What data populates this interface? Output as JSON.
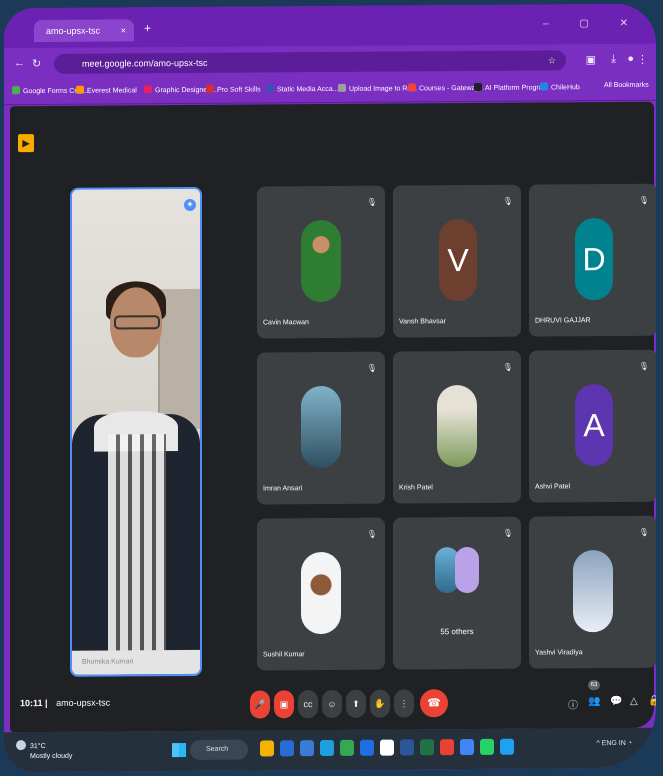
{
  "browser": {
    "tab_title": "amo-upsx-tsc",
    "tab_close": "×",
    "new_tab": "+",
    "window_controls": "– ▢ ✕",
    "url": "meet.google.com/amo-upsx-tsc",
    "bookmarks": [
      {
        "label": "Google Forms Crea...",
        "color": "#4caf50"
      },
      {
        "label": "Everest Medical",
        "color": "#ff9800"
      },
      {
        "label": "Graphic Designers...",
        "color": "#e91e63"
      },
      {
        "label": "Pro Soft Skills",
        "color": "#d32f2f"
      },
      {
        "label": "Static Media Acca...",
        "color": "#3f51b5"
      },
      {
        "label": "Upload Image to Re...",
        "color": "#9e9e9e"
      },
      {
        "label": "Courses - Gateway...",
        "color": "#f44336"
      },
      {
        "label": "AI Platform Program",
        "color": "#212121"
      },
      {
        "label": "ChileHub",
        "color": "#1e88e5"
      }
    ],
    "all_bookmarks": "All Bookmarks"
  },
  "meet": {
    "self_name": "Bhumika Kumari",
    "participants": [
      {
        "name": "Cavin Macwan",
        "type": "photo",
        "color": "#2e7d32"
      },
      {
        "name": "Vansh Bhavsar",
        "type": "letter",
        "letter": "V",
        "color": "#6d3f2f"
      },
      {
        "name": "DHRUVI GAJJAR",
        "type": "letter",
        "letter": "D",
        "color": "#00838f"
      },
      {
        "name": "Imran Ansari",
        "type": "photo",
        "color": "#4a6a80"
      },
      {
        "name": "Krish Patel",
        "type": "photo",
        "color": "#7d9a5a"
      },
      {
        "name": "Ashvi Patel",
        "type": "letter",
        "letter": "A",
        "color": "#5e35b1"
      },
      {
        "name": "Sushil Kumar",
        "type": "photo",
        "color": "#e8e8e8"
      },
      {
        "name": "55 others",
        "type": "others"
      },
      {
        "name": "Yashvi Viradiya",
        "type": "photo",
        "color": "#b3c4d6"
      }
    ],
    "time": "10:11",
    "meeting_code": "amo-upsx-tsc",
    "participant_count": "63"
  },
  "taskbar": {
    "temperature": "31°C",
    "condition": "Mostly cloudy",
    "search": "Search",
    "tray_lang": "ENG IN"
  }
}
